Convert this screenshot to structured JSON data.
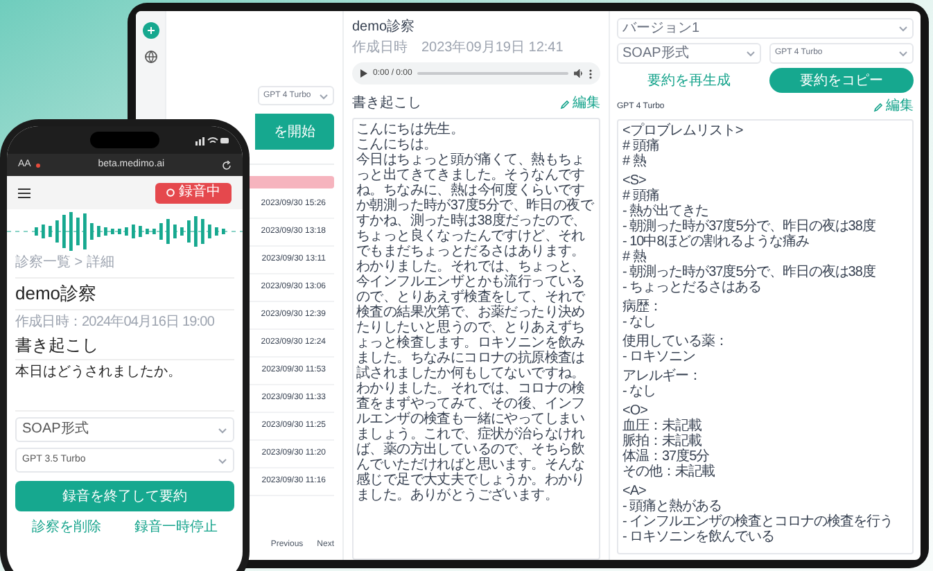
{
  "laptop": {
    "list_panel": {
      "model_select": "GPT 4 Turbo",
      "start_button": "を開始",
      "rows": [
        "2023/09/30 15:26",
        "2023/09/30 13:18",
        "2023/09/30 13:11",
        "2023/09/30 13:06",
        "2023/09/30 12:39",
        "2023/09/30 12:24",
        "2023/09/30 11:53",
        "2023/09/30 11:33",
        "2023/09/30 11:25",
        "2023/09/30 11:20",
        "2023/09/30 11:16"
      ],
      "pagination": [
        "Previous",
        "Next"
      ]
    },
    "detail_panel": {
      "title": "demo診察",
      "created": "作成日時　2023年09月19日 12:41",
      "audio_time": "0:00 / 0:00",
      "section_title": "書き起こし",
      "edit": "編集",
      "transcript": [
        "こんにちは先生。",
        "こんにちは。",
        "今日はちょっと頭が痛くて、熱もちょっと出てきてきました。そうなんですね。ちなみに、熱は今何度くらいですか朝測った時が37度5分で、昨日の夜ですかね、測った時は38度だったので、ちょっと良くなったんですけど、それでもまだちょっとだるさはあります。",
        "わかりました。それでは、ちょっと、今インフルエンザとかも流行っているので、とりあえず検査をして、それで検査の結果次第で、お薬だったり決めたりしたいと思うので、とりあえずちょっと検査します。ロキソニンを飲みました。ちなみにコロナの抗原検査は試されましたか何もしてないですね。わかりました。それでは、コロナの検査をまずやってみて、その後、インフルエンザの検査も一緒にやってしまいましょう。これで、症状が治らなければ、薬の方出しているので、そちら飲んでいただければと思います。そんな感じで足で大丈夫でしょうか。わかりました。ありがとうございます。"
      ]
    },
    "summary_panel": {
      "version_select": "バージョン1",
      "format_select": "SOAP形式",
      "model_select": "GPT 4 Turbo",
      "regenerate_button": "要約を再生成",
      "copy_button": "要約をコピー",
      "model_label": "GPT 4 Turbo",
      "edit": "編集",
      "sections": [
        [
          "<プロブレムリスト>",
          "# 頭痛",
          "# 熱"
        ],
        [
          "<S>",
          "# 頭痛",
          "- 熱が出てきた",
          "- 朝測った時が37度5分で、昨日の夜は38度",
          "- 10中8ほどの割れるような痛み",
          "# 熱",
          "- 朝測った時が37度5分で、昨日の夜は38度",
          "- ちょっとだるさはある"
        ],
        [
          "病歴：",
          "- なし"
        ],
        [
          "使用している薬：",
          "- ロキソニン"
        ],
        [
          "アレルギー：",
          "- なし"
        ],
        [
          "<O>",
          "血圧：未記載",
          "脈拍：未記載",
          "体温：37度5分",
          "その他：未記載"
        ],
        [
          "<A>",
          "- 頭痛と熱がある",
          "- インフルエンザの検査とコロナの検査を行う",
          "- ロキソニンを飲んでいる"
        ]
      ]
    }
  },
  "phone": {
    "browser": {
      "text_size": "AA",
      "url": "beta.medimo.ai"
    },
    "record_button": "録音中",
    "breadcrumb": "診察一覧 > 詳細",
    "title": "demo診察",
    "created": "作成日時：2024年04月16日 19:00",
    "section_title": "書き起こし",
    "transcript": "本日はどうされましたか。",
    "selects": [
      "SOAP形式",
      "GPT 3.5 Turbo"
    ],
    "primary_button": "録音を終了して要約",
    "links": [
      "診察を削除",
      "録音一時停止"
    ]
  }
}
